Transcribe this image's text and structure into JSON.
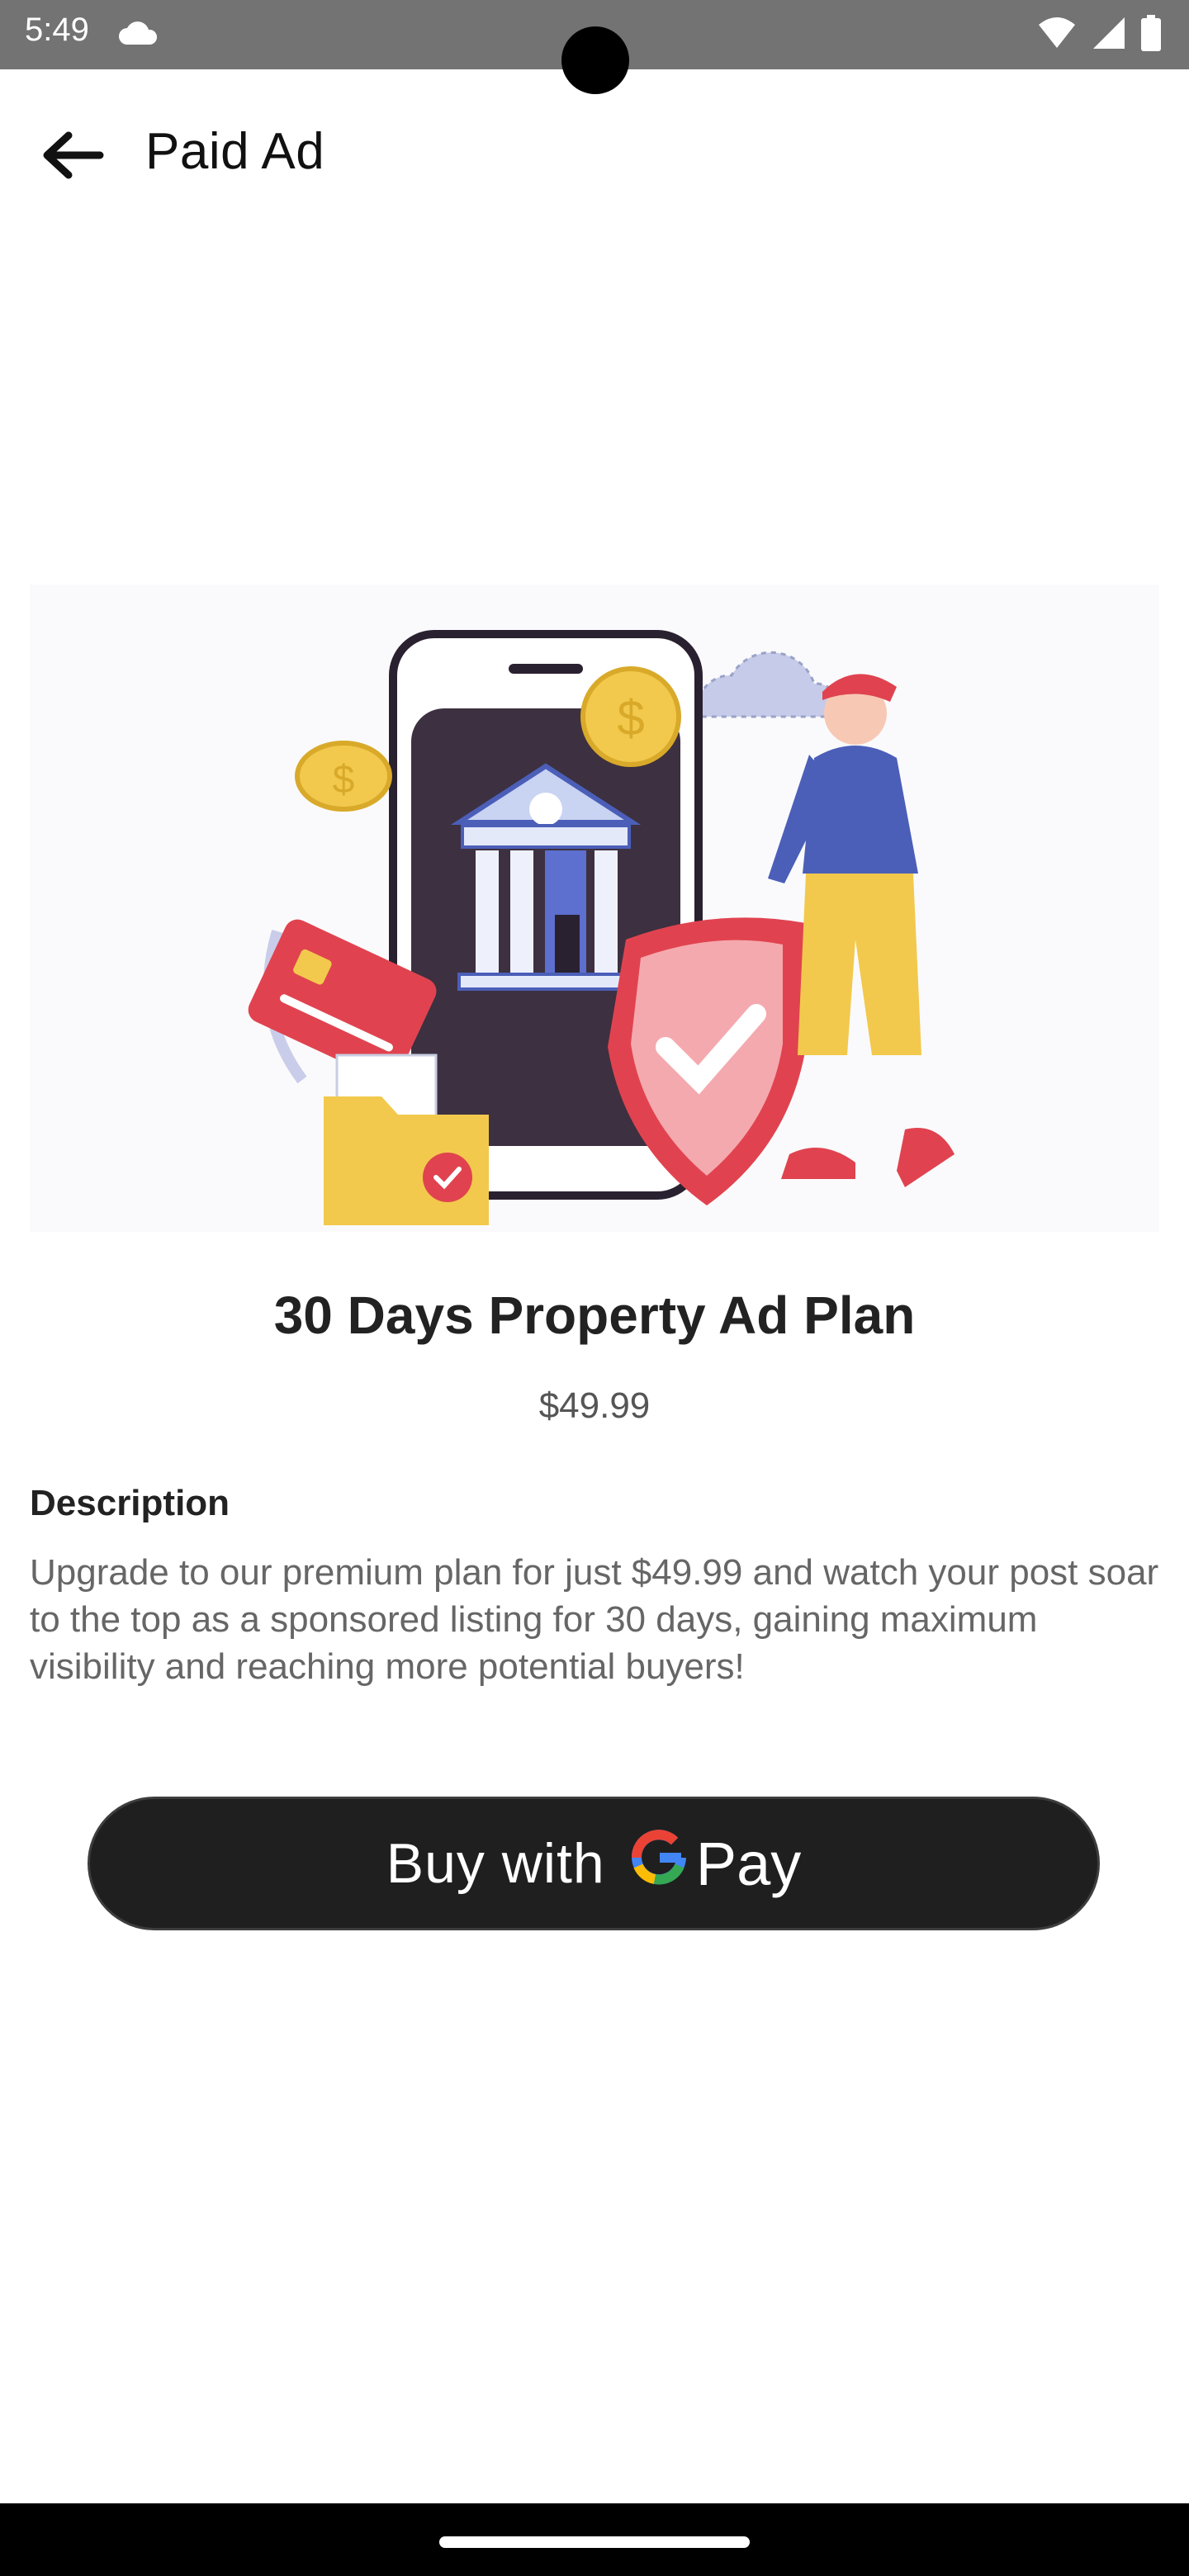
{
  "status_bar": {
    "time": "5:49",
    "icons": [
      "cloud-icon",
      "wifi-icon",
      "signal-icon",
      "battery-icon"
    ]
  },
  "app_bar": {
    "back_icon": "arrow-left-icon",
    "title": "Paid Ad"
  },
  "hero": {
    "illustration": "payment-security-illustration"
  },
  "plan": {
    "title": "30 Days Property Ad Plan",
    "price": "$49.99"
  },
  "description": {
    "heading": "Description",
    "body": "Upgrade to our premium plan for just $49.99 and watch your post soar to the top as a sponsored listing for 30 days, gaining maximum visibility and reaching more potential buyers!"
  },
  "payment_button": {
    "label": "Buy with",
    "brand_letter": "G",
    "brand_word": "Pay"
  },
  "colors": {
    "status_bar": "#737373",
    "button_bg": "#1f1f1f",
    "title_text": "#222222",
    "body_text": "#666666"
  }
}
